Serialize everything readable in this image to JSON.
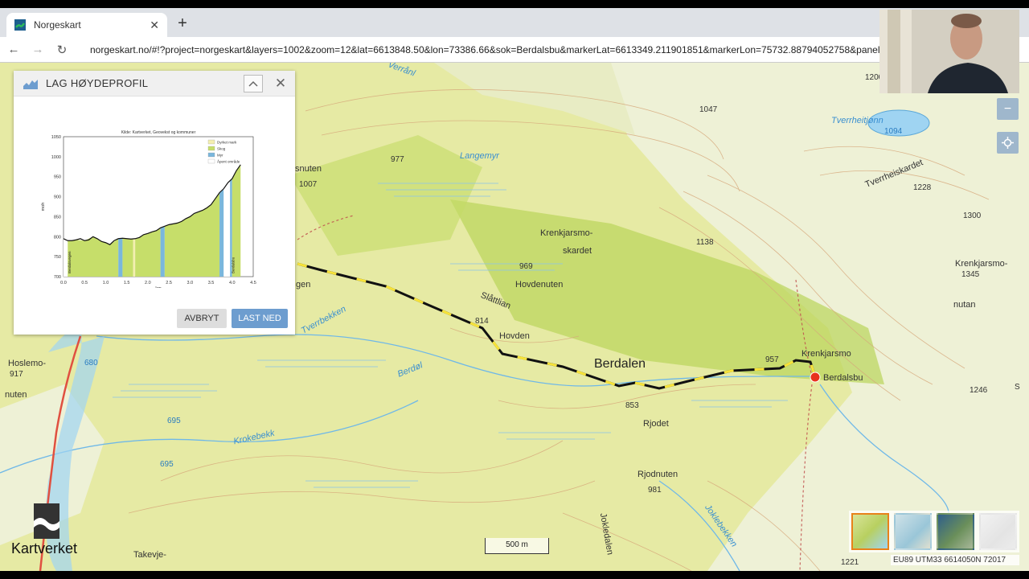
{
  "browser": {
    "tab_title": "Norgeskart",
    "new_tab": "+",
    "tab_close": "✕",
    "url": "norgeskart.no/#!?project=norgeskart&layers=1002&zoom=12&lat=6613848.50&lon=73386.66&sok=Berdalsbu&markerLat=6613349.211901851&markerLon=75732.88794052758&panel=s"
  },
  "panel": {
    "title": "LAG HØYDEPROFIL",
    "cancel_label": "AVBRYT",
    "download_label": "LAST NED"
  },
  "chart_data": {
    "type": "area",
    "title": "Kilde: Kartverket, Geovekst og kommuner",
    "xlabel": "km",
    "ylabel": "moh",
    "xlim": [
      0,
      4.5
    ],
    "ylim": [
      700,
      1050
    ],
    "x_ticks": [
      "0.0",
      "0.5",
      "1.0",
      "1.5",
      "2.0",
      "2.5",
      "3.0",
      "3.5",
      "4.0",
      "4.5"
    ],
    "y_ticks": [
      "700",
      "750",
      "800",
      "850",
      "900",
      "950",
      "1000",
      "1050"
    ],
    "x": [
      0,
      0.1,
      0.2,
      0.3,
      0.4,
      0.5,
      0.6,
      0.7,
      0.8,
      0.9,
      1.0,
      1.1,
      1.2,
      1.3,
      1.4,
      1.5,
      1.6,
      1.7,
      1.8,
      1.9,
      2.0,
      2.1,
      2.2,
      2.3,
      2.4,
      2.5,
      2.6,
      2.7,
      2.8,
      2.9,
      3.0,
      3.1,
      3.2,
      3.3,
      3.4,
      3.5,
      3.6,
      3.7,
      3.8,
      3.9,
      4.0,
      4.1,
      4.2
    ],
    "y": [
      795,
      790,
      790,
      792,
      795,
      790,
      792,
      800,
      795,
      788,
      785,
      780,
      790,
      795,
      796,
      795,
      794,
      795,
      798,
      805,
      808,
      812,
      815,
      822,
      826,
      830,
      832,
      834,
      838,
      845,
      850,
      858,
      862,
      866,
      872,
      880,
      895,
      910,
      920,
      935,
      945,
      965,
      980
    ],
    "legend": [
      "Dyrket mark",
      "Skog",
      "Myr",
      "Åpent område"
    ],
    "legend_colors": [
      "#f4efb0",
      "#c6de6a",
      "#7ab7dc",
      "#ffffff"
    ],
    "zones": [
      {
        "from": 0,
        "to": 0.1,
        "type": "Åpent område"
      },
      {
        "from": 0.1,
        "to": 1.3,
        "type": "Skog"
      },
      {
        "from": 1.3,
        "to": 1.4,
        "type": "Myr"
      },
      {
        "from": 1.4,
        "to": 1.65,
        "type": "Skog"
      },
      {
        "from": 1.65,
        "to": 1.7,
        "type": "Dyrket mark"
      },
      {
        "from": 1.7,
        "to": 2.3,
        "type": "Skog"
      },
      {
        "from": 2.3,
        "to": 2.4,
        "type": "Myr"
      },
      {
        "from": 2.4,
        "to": 3.7,
        "type": "Skog"
      },
      {
        "from": 3.7,
        "to": 3.8,
        "type": "Myr"
      },
      {
        "from": 3.8,
        "to": 3.95,
        "type": "Åpent område"
      },
      {
        "from": 3.95,
        "to": 4.0,
        "type": "Myr"
      },
      {
        "from": 4.0,
        "to": 4.2,
        "type": "Skog"
      }
    ],
    "start_label": "Berdalsvegen",
    "end_label": "Berdalsbu"
  },
  "map": {
    "title_berdalen": "Berdalen",
    "labels": [
      "Langemyr",
      "977",
      "1007",
      "snuten",
      "Krenkjarsmo-",
      "skardet",
      "969",
      "1138",
      "Hovdenuten",
      "Slåttlian",
      "814",
      "Hovden",
      "Tverrheitjønn",
      "1094",
      "Tverrheiskardet",
      "1228",
      "1300",
      "Krenkjarsmo-",
      "1345",
      "nutan",
      "1047",
      "1200",
      "Krenkjarsmo",
      "957",
      "Berdalsbu",
      "853",
      "Rjodet",
      "Rjodnuten",
      "981",
      "Jokledalen",
      "Joklebekken",
      "Krokebekk",
      "Berdøl",
      "Tverrbekken",
      "Hoslemo-",
      "917",
      "nuten",
      "680",
      "695",
      "695",
      "Takevje-",
      "gen",
      "1246",
      "1221",
      "S",
      "Verrånl"
    ],
    "scale_label": "500 m",
    "coords": "EU89 UTM33 6614050N 72017"
  },
  "logo": {
    "text": "Kartverket"
  },
  "colors": {
    "forest": "#c8dd6e",
    "open": "#eef2d4",
    "water": "#6fb8e8",
    "route_yellow": "#f7e33a",
    "accent_blue": "#6d9dcf"
  }
}
